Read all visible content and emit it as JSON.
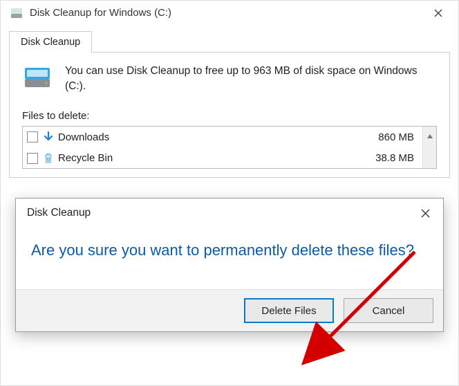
{
  "window": {
    "title": "Disk Cleanup for Windows (C:)"
  },
  "tab": {
    "label": "Disk Cleanup"
  },
  "info": {
    "text": "You can use Disk Cleanup to free up to 963 MB of disk space on Windows (C:)."
  },
  "files_label": "Files to delete:",
  "files": [
    {
      "name": "Downloads",
      "size": "860 MB",
      "icon": "download-arrow"
    },
    {
      "name": "Recycle Bin",
      "size": "38.8 MB",
      "icon": "recycle-bin"
    }
  ],
  "dialog": {
    "title": "Disk Cleanup",
    "message": "Are you sure you want to permanently delete these files?",
    "primary_label": "Delete Files",
    "cancel_label": "Cancel"
  }
}
